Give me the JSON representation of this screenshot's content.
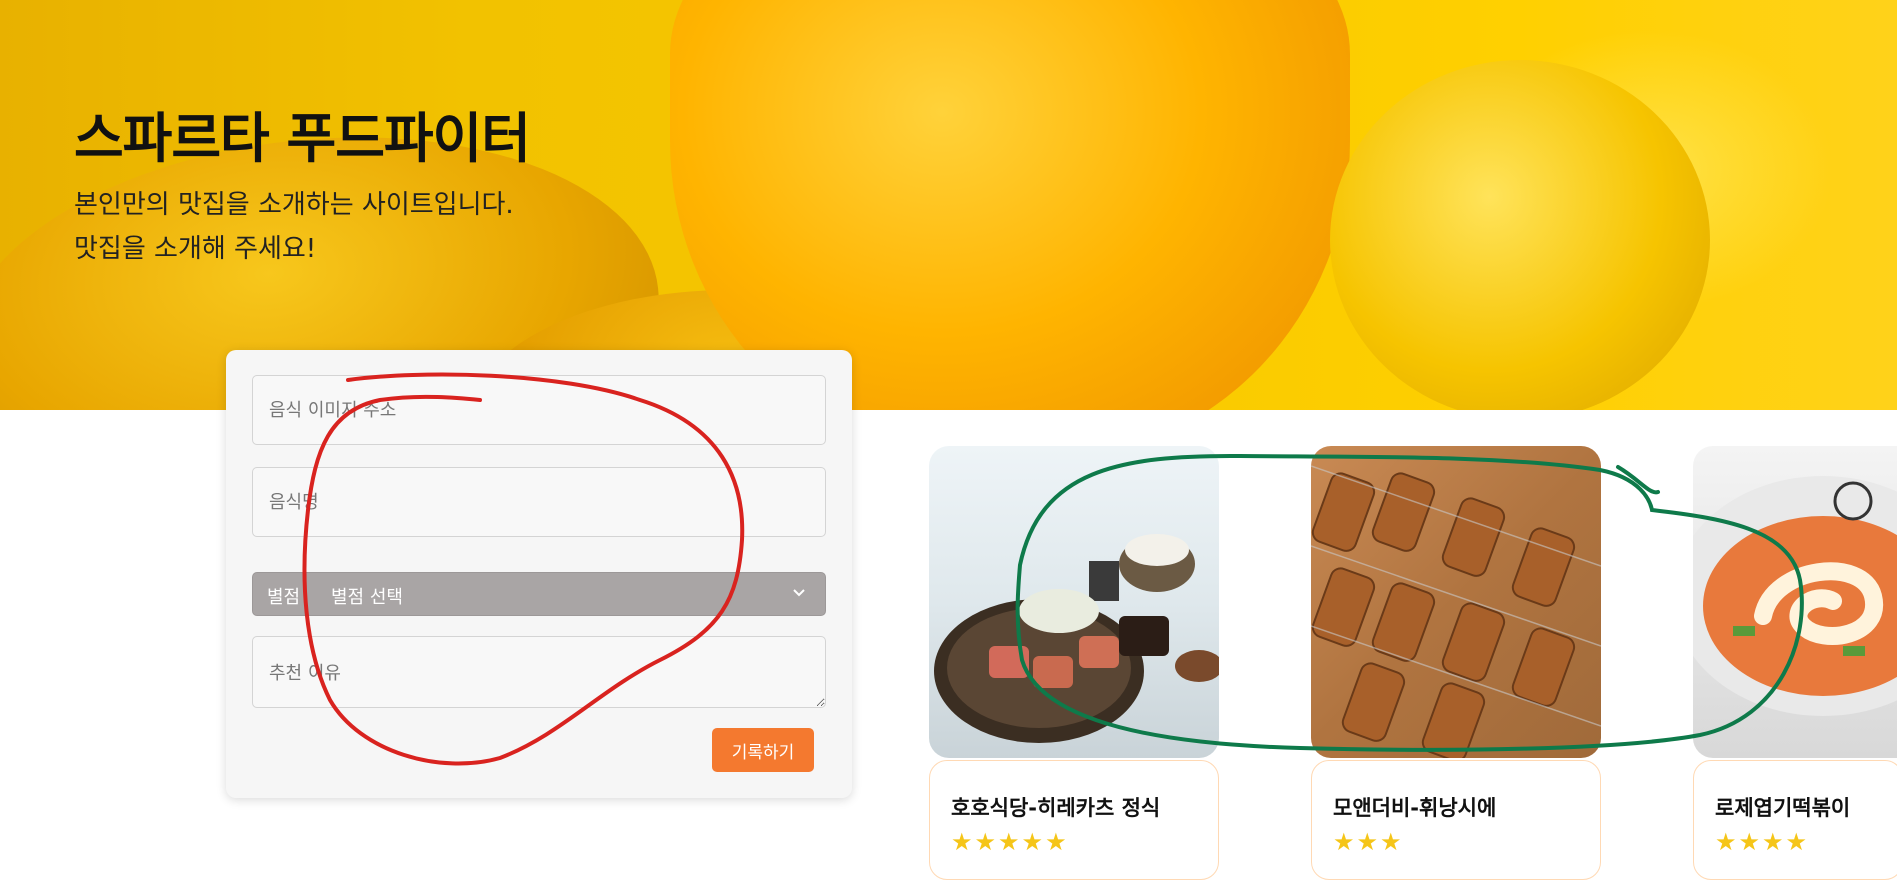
{
  "hero": {
    "title": "스파르타 푸드파이터",
    "subtitle_line1": "본인만의 맛집을 소개하는 사이트입니다.",
    "subtitle_line2": "맛집을 소개해 주세요!"
  },
  "form": {
    "image_url_placeholder": "음식 이미지 주소",
    "food_name_placeholder": "음식명",
    "rating_label": "별점",
    "rating_selected": "별점 선택",
    "reason_placeholder": "추천 이유",
    "submit_label": "기록하기"
  },
  "cards": [
    {
      "title": "호호식당-히레카츠 정식",
      "stars": "★★★★★",
      "rating": 5
    },
    {
      "title": "모앤더비-휘낭시에",
      "stars": "★★★",
      "rating": 3
    },
    {
      "title": "로제엽기떡볶이",
      "stars": "★★★★",
      "rating": 4
    }
  ],
  "colors": {
    "accent": "#f4792f",
    "hero_yellow": "#ffd000",
    "annotation_red": "#d9231f",
    "annotation_green": "#0e7a4a",
    "star": "#f5c518"
  }
}
